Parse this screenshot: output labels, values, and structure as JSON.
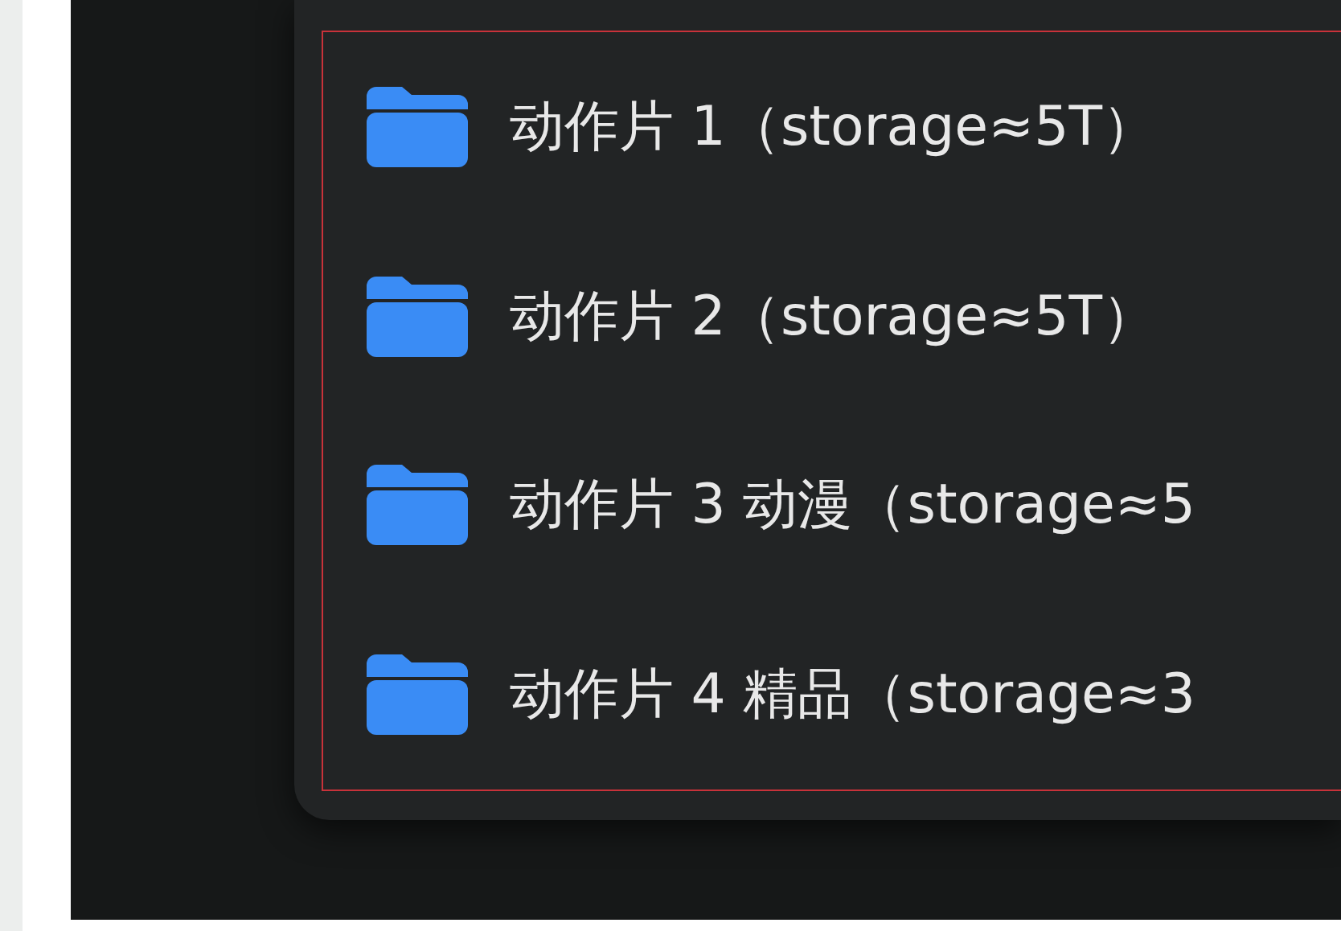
{
  "folders": [
    {
      "name": "动作片 1（storage≈5T）"
    },
    {
      "name": "动作片 2（storage≈5T）"
    },
    {
      "name": "动作片 3 动漫（storage≈5"
    },
    {
      "name": "动作片 4 精品（storage≈3"
    }
  ]
}
